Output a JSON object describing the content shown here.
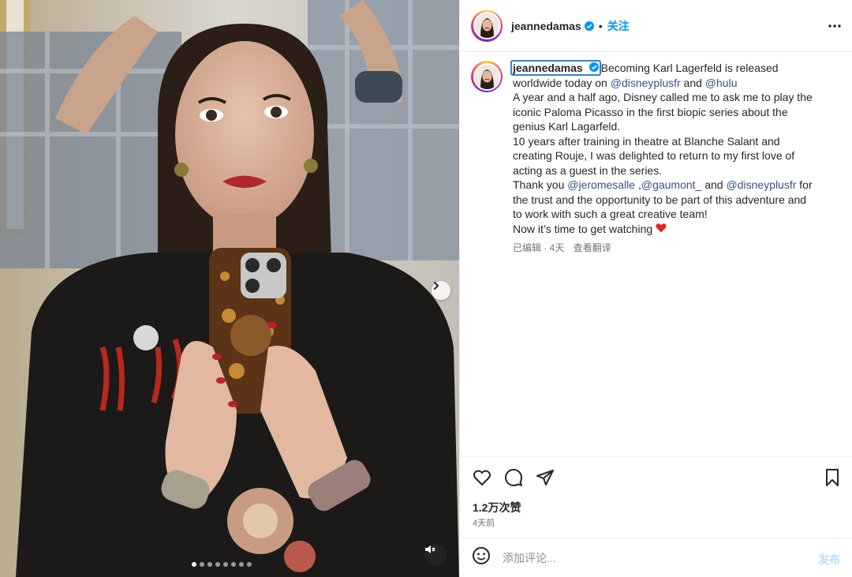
{
  "colors": {
    "accent": "#0095f6",
    "mention": "#385185",
    "post_disabled": "#b2dffc",
    "heart": "#e02424"
  },
  "media": {
    "slide_count": 8,
    "active_slide": 1,
    "next_icon": "chevron-right-icon",
    "mute_icon": "speaker-muted-icon"
  },
  "header": {
    "username": "jeannedamas",
    "separator": "•",
    "follow_label": "关注",
    "more_icon": "more-horizontal-icon"
  },
  "caption": {
    "username": "jeannedamas",
    "lines": {
      "l1": "Becoming Karl Lagerfeld is released",
      "l2a": "worldwide today on ",
      "l2_mention1": "@disneyplusfr",
      "l2b": " and ",
      "l2_mention2": "@hulu",
      "l3": "A year and a half ago, Disney called me to ask me to play the",
      "l4": "iconic Paloma Picasso in the first biopic series about the",
      "l5": "genius Karl Lagarfeld.",
      "l6": "10 years after training in theatre at Blanche Salant and",
      "l7": "creating Rouje, I was delighted to return to my first love of",
      "l8": "acting as a guest in the series.",
      "l9a": "Thank you ",
      "l9_mention1": "@jeromesalle",
      "l9b": " ,",
      "l9_mention2": "@gaumont_",
      "l9c": " and ",
      "l9_mention3": "@disneyplusfr",
      "l9d": " for",
      "l10": "the trust and the opportunity to be part of this adventure and",
      "l11": "to work with such a great creative team!",
      "l12": "Now it’s time to get watching "
    },
    "edited": "已编辑 · 4天",
    "translate": "查看翻译"
  },
  "actions": {
    "like_icon": "heart-icon",
    "comment_icon": "comment-icon",
    "share_icon": "share-icon",
    "save_icon": "bookmark-icon",
    "likes": "1.2万次赞",
    "time_ago": "4天前"
  },
  "comment_box": {
    "emoji_icon": "emoji-icon",
    "placeholder": "添加评论...",
    "post_label": "发布"
  }
}
